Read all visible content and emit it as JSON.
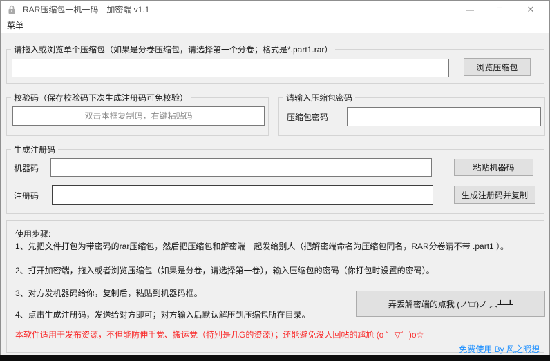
{
  "titlebar": {
    "app_icon": "lock-icon",
    "title": "RAR压缩包一机一码　加密端 v1.1",
    "minimize_glyph": "—",
    "maximize_glyph": "□",
    "close_glyph": "✕"
  },
  "menubar": {
    "menu_label": "菜单"
  },
  "archive_group": {
    "label": "请拖入或浏览单个压缩包（如果是分卷压缩包，请选择第一个分卷；格式是*.part1.rar）",
    "path_value": "",
    "browse_button": "浏览压缩包"
  },
  "checkcode_group": {
    "label": "校验码（保存校验码下次生成注册码可免校验）",
    "placeholder": "双击本框复制码，右键粘贴码",
    "value": ""
  },
  "password_group": {
    "label": "请输入压缩包密码",
    "field_label": "压缩包密码",
    "value": ""
  },
  "regcode_group": {
    "label": "生成注册码",
    "machine_code_label": "机器码",
    "machine_code_value": "",
    "reg_code_label": "注册码",
    "reg_code_value": "",
    "paste_button": "粘贴机器码",
    "generate_button": "生成注册码并复制"
  },
  "steps_panel": {
    "heading": "使用步骤:",
    "steps": [
      "1、先把文件打包为带密码的rar压缩包，然后把压缩包和解密端一起发给别人（把解密端命名为压缩包同名，RAR分卷请不带 .part1 ）。",
      "2、打开加密端，拖入或者浏览压缩包（如果是分卷，请选择第一卷），输入压缩包的密码（你打包时设置的密码）。",
      "3、对方发机器码给你，复制后，粘贴到机器码框。",
      "4、点击生成注册码，发送给对方即可；对方输入后默认解压到压缩包所在目录。"
    ],
    "lost_decoder_button": "弄丢解密端的点我 (ノ'□')ノ ︵┻━┻",
    "warning_text": "本软件适用于发布资源，不但能防伸手党、搬运党（特别是几G的资源）；还能避免没人回帖的尴尬 (o ゜▽゜)o☆",
    "credit_text": "免费使用 By 风之暇想"
  },
  "colors": {
    "warning_red": "#f92b2b",
    "credit_blue": "#1e90ff",
    "client_bg": "#f0f0f0"
  }
}
